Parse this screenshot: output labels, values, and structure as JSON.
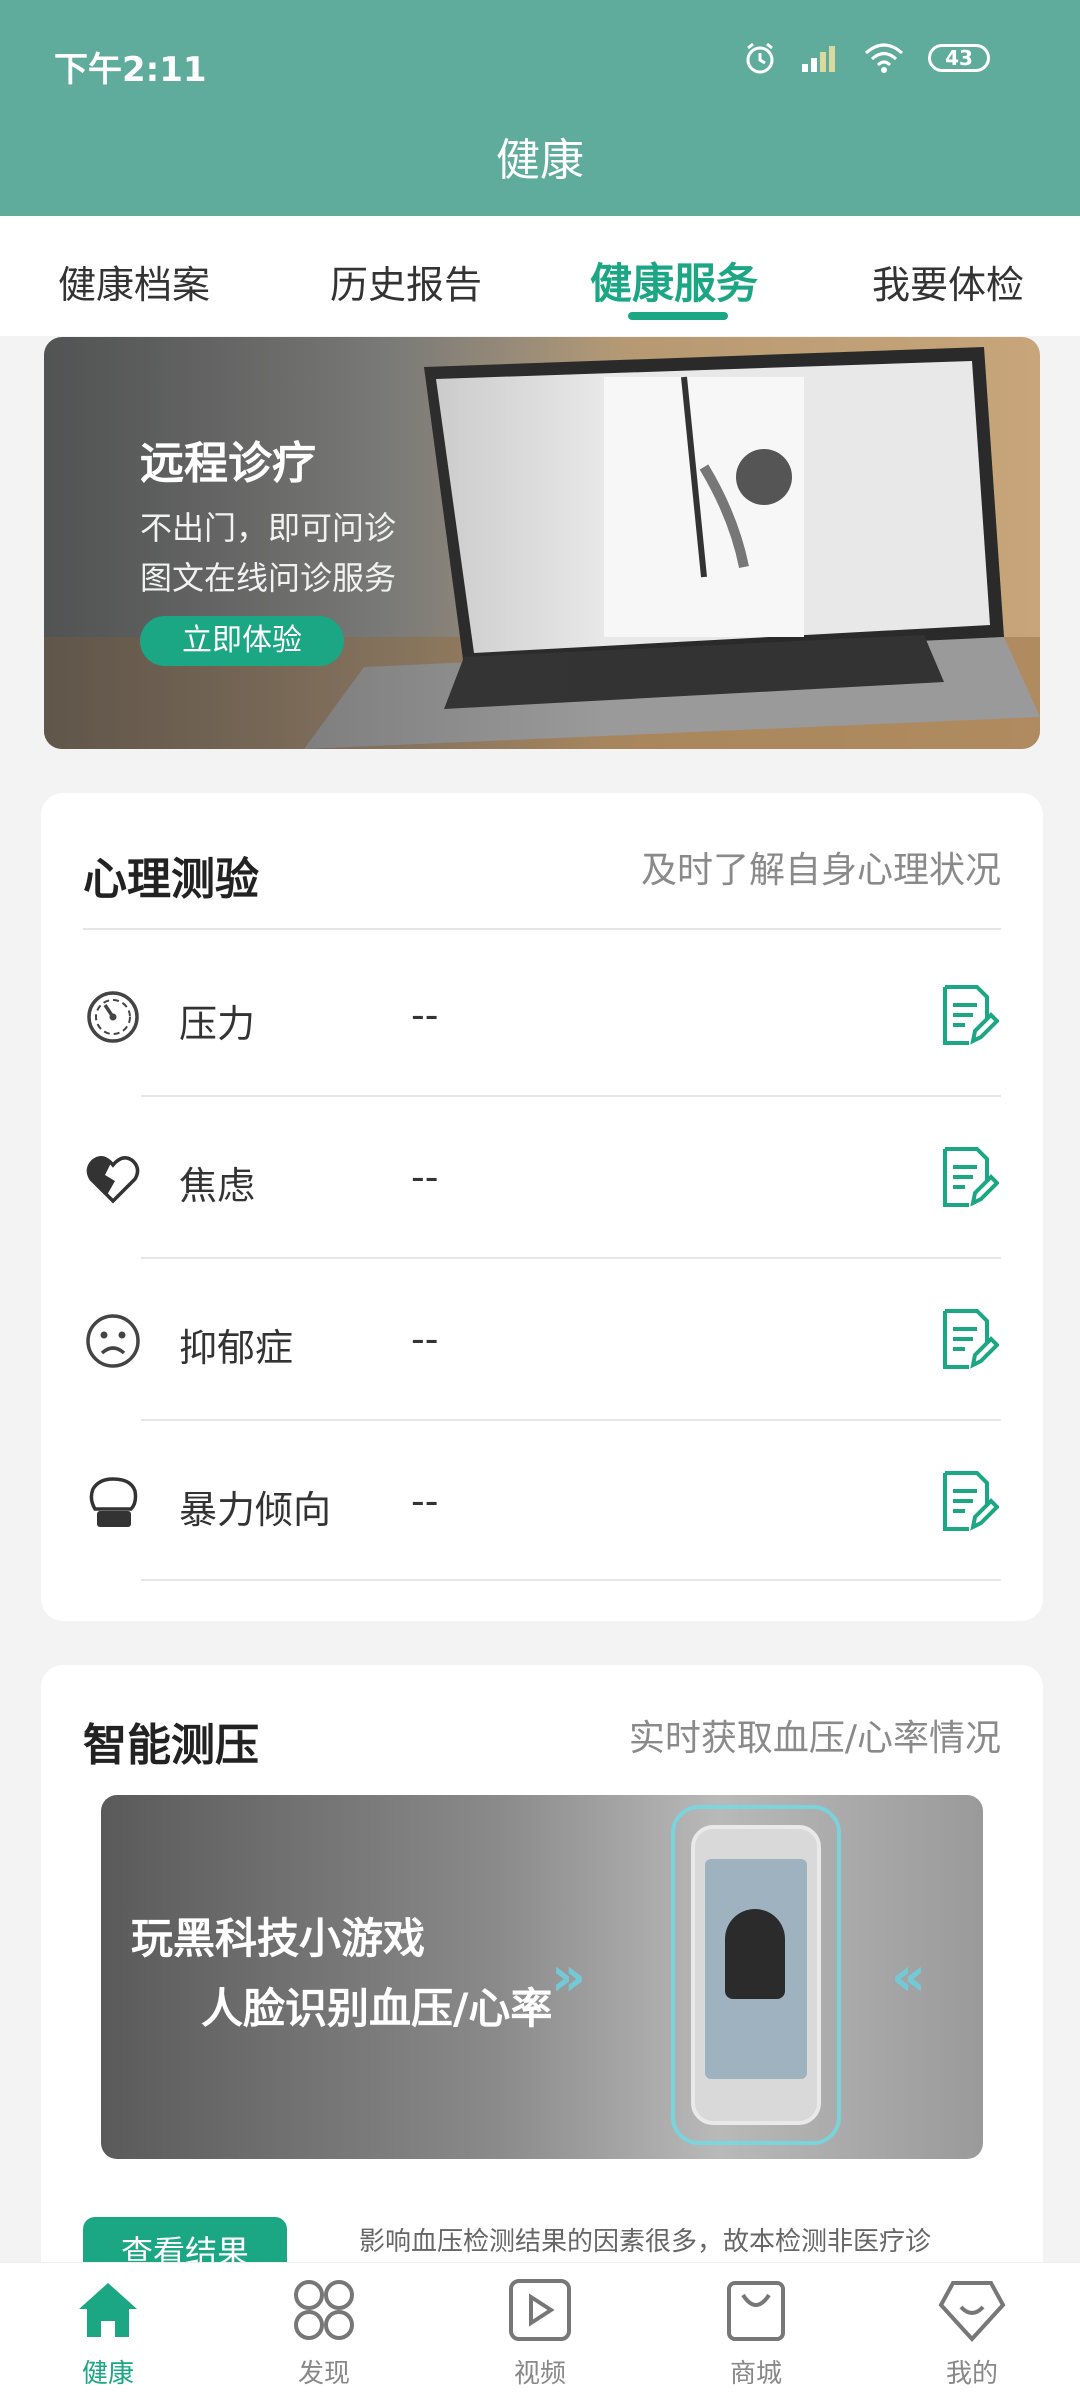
{
  "status_bar": {
    "time": "下午2:11",
    "battery": "43"
  },
  "header": {
    "title": "健康"
  },
  "tabs": [
    {
      "label": "健康档案",
      "active": false
    },
    {
      "label": "历史报告",
      "active": false
    },
    {
      "label": "健康服务",
      "active": true
    },
    {
      "label": "我要体检",
      "active": false
    }
  ],
  "banner": {
    "title": "远程诊疗",
    "line1": "不出门，即可问诊",
    "line2": "图文在线问诊服务",
    "button": "立即体验"
  },
  "psych_card": {
    "title": "心理测验",
    "subtitle": "及时了解自身心理状况",
    "rows": [
      {
        "label": "压力",
        "value": "--",
        "icon": "gauge-icon"
      },
      {
        "label": "焦虑",
        "value": "--",
        "icon": "broken-heart-icon"
      },
      {
        "label": "抑郁症",
        "value": "--",
        "icon": "sad-face-icon"
      },
      {
        "label": "暴力倾向",
        "value": "--",
        "icon": "boxing-glove-icon"
      }
    ]
  },
  "bp_card": {
    "title": "智能测压",
    "subtitle": "实时获取血压/心率情况",
    "banner_line1": "玩黑科技小游戏",
    "banner_line2": "人脸识别血压/心率",
    "check_button": "查看结果",
    "disclaimer": "影响血压检测结果的因素很多，故本检测非医疗诊"
  },
  "bottom_nav": [
    {
      "label": "健康",
      "icon": "home-icon",
      "active": true
    },
    {
      "label": "发现",
      "icon": "grid-icon",
      "active": false
    },
    {
      "label": "视频",
      "icon": "video-icon",
      "active": false
    },
    {
      "label": "商城",
      "icon": "shopping-bag-icon",
      "active": false
    },
    {
      "label": "我的",
      "icon": "profile-icon",
      "active": false
    }
  ],
  "colors": {
    "header": "#5fac9d",
    "accent": "#1ca784"
  }
}
